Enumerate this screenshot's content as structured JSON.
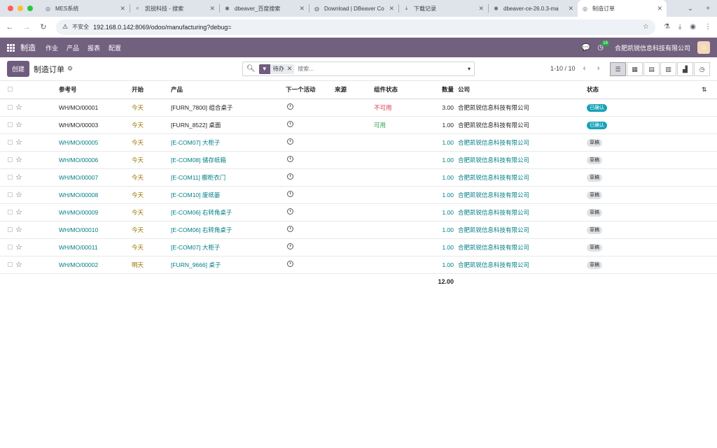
{
  "browser": {
    "tabs": [
      {
        "title": "MES系统",
        "icon": "odoo-icon",
        "active": false
      },
      {
        "title": "凯锐科技 - 搜索",
        "icon": "search-icon",
        "active": false
      },
      {
        "title": "dbeaver_百度搜索",
        "icon": "baidu-icon",
        "active": false
      },
      {
        "title": "Download | DBeaver Co",
        "icon": "globe-icon",
        "active": false
      },
      {
        "title": "下载记录",
        "icon": "download-icon",
        "active": false
      },
      {
        "title": "dbeaver-ce-26.0.3-ma",
        "icon": "baidu-icon",
        "active": false
      },
      {
        "title": "制造订单",
        "icon": "odoo-icon",
        "active": true
      }
    ],
    "insecure_label": "不安全",
    "url": "192.168.0.142:8069/odoo/manufacturing?debug="
  },
  "navbar": {
    "brand": "制造",
    "menu": [
      "作业",
      "产品",
      "报表",
      "配置"
    ],
    "activity_count": "16",
    "company": "合肥凯锐信息科技有限公司"
  },
  "control": {
    "create_label": "创建",
    "breadcrumb": "制造订单",
    "facet_value": "待办",
    "search_placeholder": "搜索...",
    "pager": "1-10 / 10"
  },
  "table": {
    "headers": {
      "reference": "参考号",
      "start": "开始",
      "product": "产品",
      "next_activity": "下一个活动",
      "source": "来源",
      "component_status": "组件状态",
      "quantity": "数量",
      "company": "公司",
      "state": "状态"
    },
    "rows": [
      {
        "reference": "WH/MO/00001",
        "start": "今天",
        "product": "[FURN_7800] 组合桌子",
        "component_status": "不可用",
        "quantity": "3.00",
        "company": "合肥凯锐信息科技有限公司",
        "state": "已确认",
        "style": "normal",
        "comp_color": "red",
        "state_kind": "confirmed"
      },
      {
        "reference": "WH/MO/00003",
        "start": "今天",
        "product": "[FURN_8522] 桌面",
        "component_status": "可用",
        "quantity": "1.00",
        "company": "合肥凯锐信息科技有限公司",
        "state": "已确认",
        "style": "normal",
        "comp_color": "green",
        "state_kind": "confirmed"
      },
      {
        "reference": "WH/MO/00005",
        "start": "今天",
        "product": "[E-COM07] 大柜子",
        "component_status": "",
        "quantity": "1.00",
        "company": "合肥凯锐信息科技有限公司",
        "state": "草稿",
        "style": "draft",
        "comp_color": "",
        "state_kind": "draft"
      },
      {
        "reference": "WH/MO/00006",
        "start": "今天",
        "product": "[E-COM08] 储存纸箱",
        "component_status": "",
        "quantity": "1.00",
        "company": "合肥凯锐信息科技有限公司",
        "state": "草稿",
        "style": "draft",
        "comp_color": "",
        "state_kind": "draft"
      },
      {
        "reference": "WH/MO/00007",
        "start": "今天",
        "product": "[E-COM11] 橱柜衣门",
        "component_status": "",
        "quantity": "1.00",
        "company": "合肥凯锐信息科技有限公司",
        "state": "草稿",
        "style": "draft",
        "comp_color": "",
        "state_kind": "draft"
      },
      {
        "reference": "WH/MO/00008",
        "start": "今天",
        "product": "[E-COM10] 废纸篓",
        "component_status": "",
        "quantity": "1.00",
        "company": "合肥凯锐信息科技有限公司",
        "state": "草稿",
        "style": "draft",
        "comp_color": "",
        "state_kind": "draft"
      },
      {
        "reference": "WH/MO/00009",
        "start": "今天",
        "product": "[E-COM06] 右转角桌子",
        "component_status": "",
        "quantity": "1.00",
        "company": "合肥凯锐信息科技有限公司",
        "state": "草稿",
        "style": "draft",
        "comp_color": "",
        "state_kind": "draft"
      },
      {
        "reference": "WH/MO/00010",
        "start": "今天",
        "product": "[E-COM06] 右转角桌子",
        "component_status": "",
        "quantity": "1.00",
        "company": "合肥凯锐信息科技有限公司",
        "state": "草稿",
        "style": "draft",
        "comp_color": "",
        "state_kind": "draft"
      },
      {
        "reference": "WH/MO/00011",
        "start": "今天",
        "product": "[E-COM07] 大柜子",
        "component_status": "",
        "quantity": "1.00",
        "company": "合肥凯锐信息科技有限公司",
        "state": "草稿",
        "style": "draft",
        "comp_color": "",
        "state_kind": "draft"
      },
      {
        "reference": "WH/MO/00002",
        "start": "明天",
        "product": "[FURN_9666] 桌子",
        "component_status": "",
        "quantity": "1.00",
        "company": "合肥凯锐信息科技有限公司",
        "state": "草稿",
        "style": "draft",
        "comp_color": "",
        "state_kind": "draft"
      }
    ],
    "total_quantity": "12.00"
  },
  "colors": {
    "navbar": "#72607f",
    "primary": "#6f5b7d",
    "teal": "#017e84",
    "confirmed_badge": "#17a2b8"
  }
}
